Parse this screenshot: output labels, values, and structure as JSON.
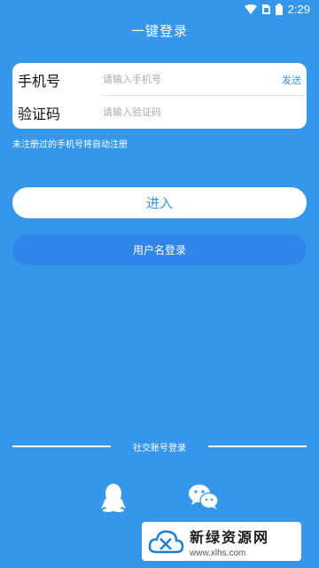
{
  "status_bar": {
    "time": "2:29",
    "icons": [
      "wifi-icon",
      "sim-icon",
      "battery-icon"
    ]
  },
  "header": {
    "title": "一键登录"
  },
  "form": {
    "phone_label": "手机号",
    "phone_placeholder": "请输入手机号",
    "phone_value": "",
    "send_label": "发送",
    "code_label": "验证码",
    "code_placeholder": "请输入验证码",
    "code_value": ""
  },
  "hint": "未注册过的手机号将自动注册",
  "buttons": {
    "enter_label": "进入",
    "username_login_label": "用户名登录"
  },
  "social": {
    "title": "社交账号登录",
    "icons": [
      "qq-icon",
      "wechat-icon"
    ]
  },
  "watermark": {
    "name": "新绿资源网",
    "url": "www.xlhs.com"
  },
  "colors": {
    "background": "#3597ec",
    "accent": "#3597ec",
    "secondary_button": "#2f85e8"
  }
}
